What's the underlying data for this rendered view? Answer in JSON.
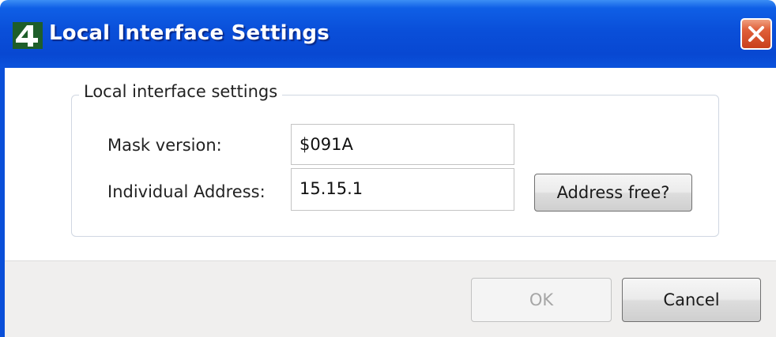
{
  "window": {
    "title": "Local Interface Settings",
    "app_icon": "ets4-logo-icon",
    "close_icon": "close-icon",
    "title_color": "#0a4fd9",
    "close_color": "#d9532d"
  },
  "group": {
    "legend": "Local interface settings",
    "mask_version": {
      "label": "Mask version:",
      "value": "$091A"
    },
    "individual_address": {
      "label": "Individual Address:",
      "value": "15.15.1"
    },
    "address_free_button": "Address free?"
  },
  "footer": {
    "ok_label": "OK",
    "ok_enabled": false,
    "cancel_label": "Cancel"
  }
}
